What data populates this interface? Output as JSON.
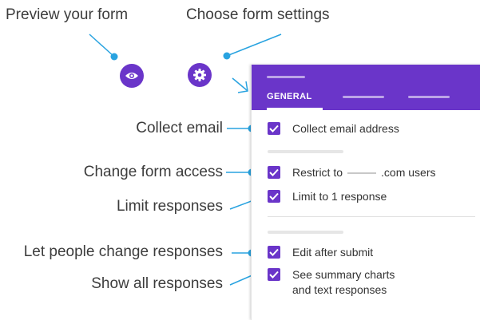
{
  "callouts": {
    "preview": "Preview your form",
    "settings": "Choose form settings",
    "collect_email": "Collect email",
    "change_access": "Change form access",
    "limit": "Limit responses",
    "let_change": "Let people change responses",
    "show_all": "Show all responses"
  },
  "icons": {
    "preview": "eye-icon",
    "settings": "gear-icon",
    "checkbox": "check-icon"
  },
  "colors": {
    "accent": "#6a35c9",
    "callout_line": "#29a3e0",
    "text": "#3c3c3c"
  },
  "panel": {
    "tab": "GENERAL",
    "options": [
      {
        "label": "Collect email address",
        "checked": true
      },
      {
        "label_before": "Restrict to",
        "label_after": ".com users",
        "checked": true
      },
      {
        "label": "Limit to 1 response",
        "checked": true
      },
      {
        "label": "Edit after submit",
        "checked": true
      },
      {
        "label_line1": "See summary charts",
        "label_line2": "and text responses",
        "checked": true
      }
    ]
  }
}
